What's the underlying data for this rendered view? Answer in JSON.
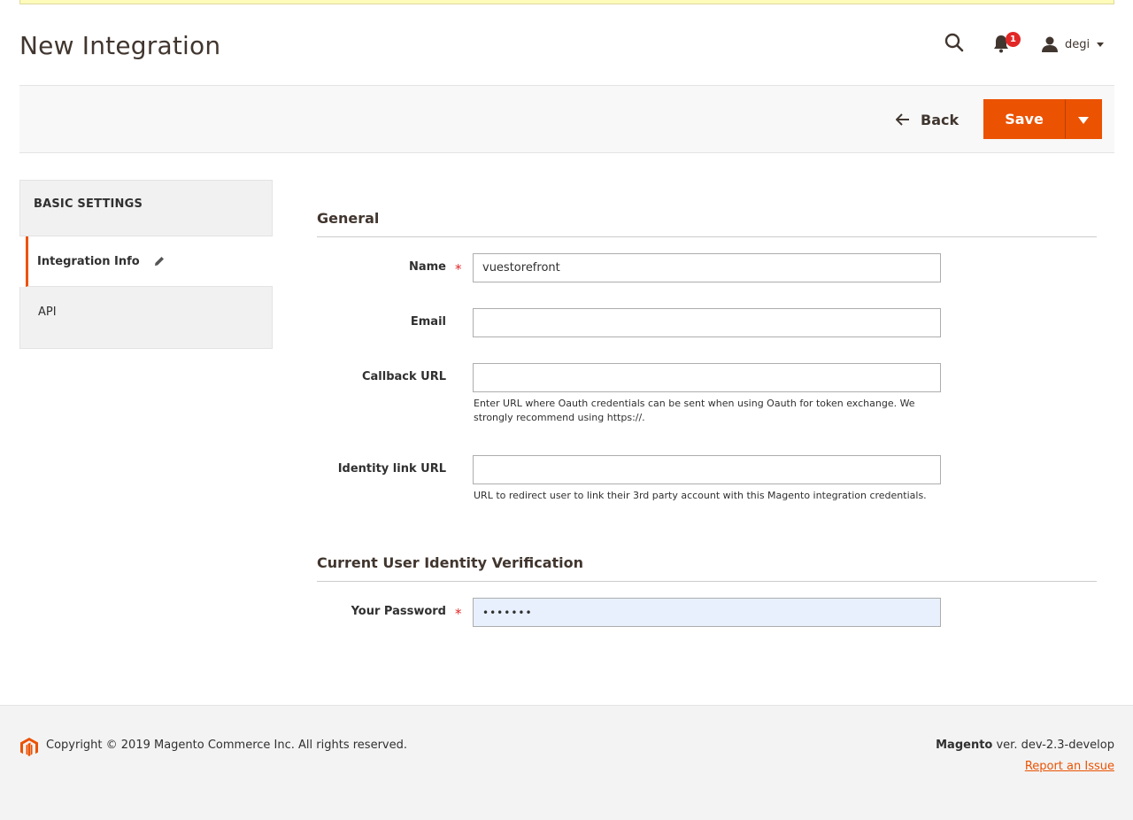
{
  "header": {
    "title": "New Integration",
    "notification_count": "1",
    "user_name": "degi"
  },
  "actions": {
    "back_label": "Back",
    "save_label": "Save"
  },
  "sidebar": {
    "heading": "BASIC SETTINGS",
    "items": [
      {
        "label": "Integration Info"
      },
      {
        "label": "API"
      }
    ]
  },
  "form": {
    "general_title": "General",
    "name_label": "Name",
    "name_value": "vuestorefront",
    "email_label": "Email",
    "email_value": "",
    "callback_label": "Callback URL",
    "callback_value": "",
    "callback_note": "Enter URL where Oauth credentials can be sent when using Oauth for token exchange. We strongly recommend using https://.",
    "identity_label": "Identity link URL",
    "identity_value": "",
    "identity_note": "URL to redirect user to link their 3rd party account with this Magento integration credentials.",
    "verification_title": "Current User Identity Verification",
    "password_label": "Your Password",
    "password_value": "•••••••",
    "required_mark": "*"
  },
  "footer": {
    "copyright": "Copyright © 2019 Magento Commerce Inc. All rights reserved.",
    "brand": "Magento",
    "version": " ver. dev-2.3-develop",
    "report_link": "Report an Issue"
  },
  "colors": {
    "accent": "#eb5202",
    "required": "#e22626",
    "autofill": "#e8f0fe"
  },
  "icons": [
    "search-icon",
    "bell-icon",
    "user-icon",
    "arrow-left-icon",
    "chevron-down-icon",
    "pencil-icon",
    "magento-logo-icon"
  ]
}
